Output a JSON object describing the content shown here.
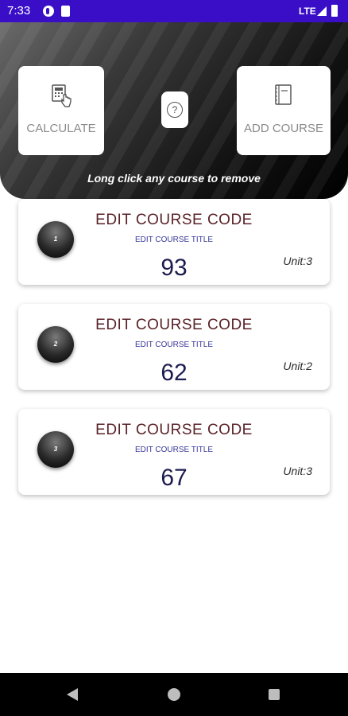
{
  "status_bar": {
    "time": "7:33",
    "network": "LTE"
  },
  "hero": {
    "calculate_label": "CALCULATE",
    "add_course_label": "ADD COURSE",
    "help_symbol": "?",
    "hint": "Long click any course to remove"
  },
  "courses": [
    {
      "index": "1",
      "code": "EDIT COURSE CODE",
      "title": "EDIT COURSE TITLE",
      "score": "93",
      "unit": "Unit:3"
    },
    {
      "index": "2",
      "code": "EDIT COURSE CODE",
      "title": "EDIT COURSE TITLE",
      "score": "62",
      "unit": "Unit:2"
    },
    {
      "index": "3",
      "code": "EDIT COURSE CODE",
      "title": "EDIT COURSE TITLE",
      "score": "67",
      "unit": "Unit:3"
    }
  ],
  "colors": {
    "status_bar": "#3a0ec7",
    "course_code": "#5a2228",
    "score": "#1c1c50"
  }
}
